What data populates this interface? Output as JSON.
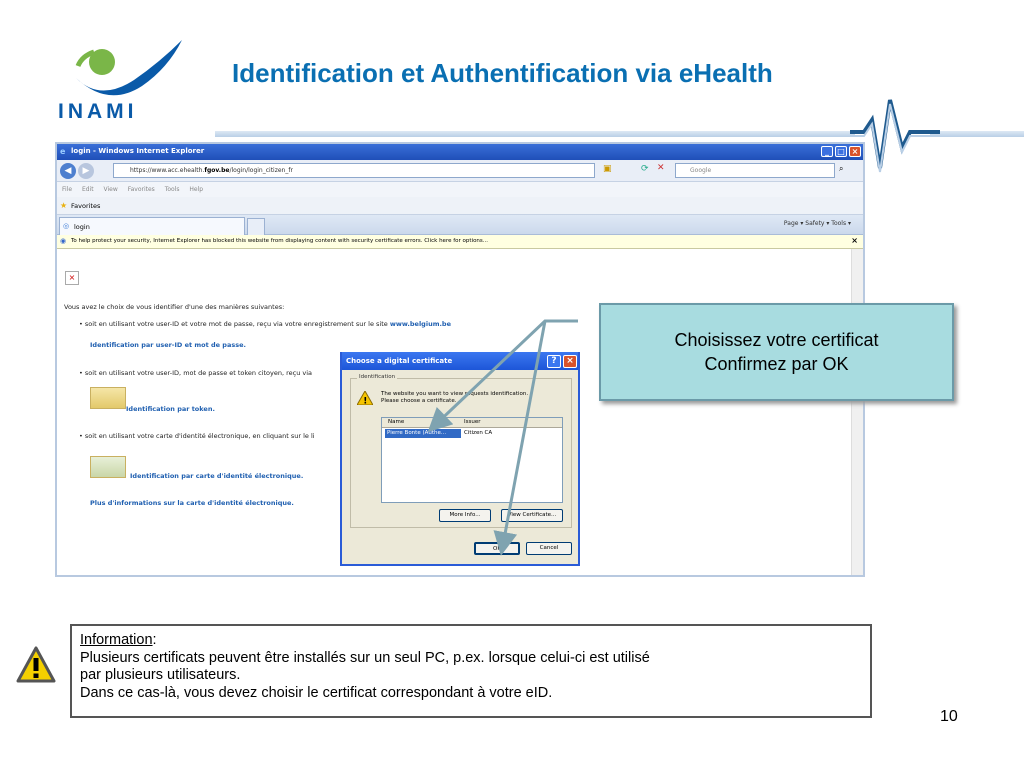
{
  "slide": {
    "title": "Identification et Authentification via eHealth",
    "logo_text": "INAMI",
    "page_number": "10"
  },
  "browser": {
    "window_title": "login - Windows Internet Explorer",
    "url_prefix": "https://www.acc.ehealth.",
    "url_domain": "fgov.be",
    "url_path": "/login/login_citizen_fr",
    "search_placeholder": "Google",
    "menu": [
      "File",
      "Edit",
      "View",
      "Favorites",
      "Tools",
      "Help"
    ],
    "favorites_label": "Favorites",
    "tab_label": "login",
    "tools_bar": "Page ▾   Safety ▾   Tools ▾",
    "security_bar": "To help protect your security, Internet Explorer has blocked this website from displaying content with security certificate errors. Click here for options..."
  },
  "page": {
    "intro": "Vous avez le choix de vous identifier d'une des manières suivantes:",
    "opt1_text": "soit en utilisant votre user-ID et votre mot de passe, reçu via votre enregistrement sur le site ",
    "opt1_site": "www.belgium.be",
    "opt1_link": "Identification par user-ID et mot de passe.",
    "opt2_text": "soit en utilisant votre user-ID, mot de passe et token citoyen, reçu via",
    "opt2_link": "Identification par token.",
    "opt3_text": "soit en utilisant votre carte d'identité électronique, en cliquant sur le li",
    "opt3_link": "Identification par carte d'identité électronique.",
    "more_link": "Plus d'informations sur la carte d'identité électronique."
  },
  "dialog": {
    "title": "Choose a digital certificate",
    "group_label": "Identification",
    "message_line1": "The website you want to view requests identification.",
    "message_line2": "Please choose a certificate.",
    "col_name": "Name",
    "col_issuer": "Issuer",
    "row_name": "Pierre Bonte (Authe...",
    "row_issuer": "Citizen CA",
    "more_info": "More Info...",
    "view_cert": "View Certificate...",
    "ok": "OK",
    "cancel": "Cancel"
  },
  "callout": {
    "line1": "Choisissez votre certificat",
    "line2": "Confirmez par OK"
  },
  "info": {
    "heading": "Information",
    "line1": "Plusieurs certificats peuvent être installés sur un seul PC, p.ex. lorsque celui-ci est utilisé",
    "line2": "par plusieurs utilisateurs.",
    "line3": "Dans ce cas-là, vous devez choisir le certificat correspondant à votre eID."
  },
  "colors": {
    "title": "#0a6fb2",
    "logo_green": "#7ab648",
    "logo_blue": "#0a5aa8",
    "callout_bg": "#a8dce0",
    "arrow": "#7fa3b0"
  },
  "icons": [
    "inami-logo",
    "ecg-line-icon",
    "warning-icon",
    "ie-icon",
    "back-icon",
    "forward-icon",
    "lock-icon",
    "refresh-icon",
    "close-icon",
    "star-icon",
    "help-icon"
  ]
}
